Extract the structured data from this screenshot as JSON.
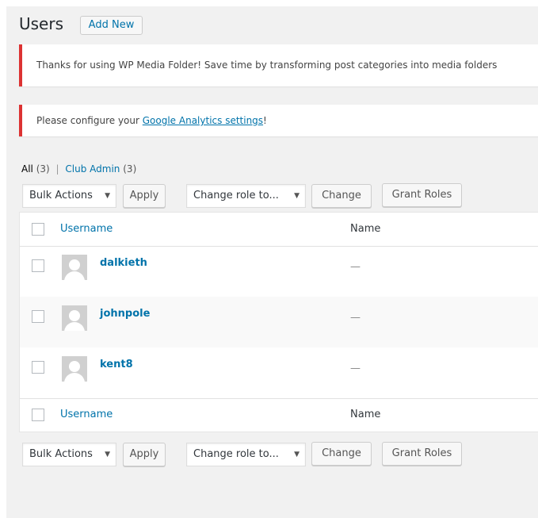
{
  "page": {
    "title": "Users",
    "add_new_label": "Add New"
  },
  "notices": {
    "wpmf": "Thanks for using WP Media Folder! Save time by transforming post categories into media folders",
    "ga_prefix": "Please configure your ",
    "ga_link": "Google Analytics settings",
    "ga_suffix": "!"
  },
  "filters": {
    "all_label": "All",
    "all_count": "(3)",
    "separator": "|",
    "club_admin_label": "Club Admin",
    "club_admin_count": "(3)"
  },
  "actions": {
    "bulk_actions": "Bulk Actions",
    "apply": "Apply",
    "change_role": "Change role to...",
    "change": "Change",
    "grant_roles": "Grant Roles"
  },
  "table": {
    "columns": {
      "username": "Username",
      "name": "Name"
    },
    "rows": [
      {
        "username": "dalkieth",
        "name": "—"
      },
      {
        "username": "johnpole",
        "name": "—"
      },
      {
        "username": "kent8",
        "name": "—"
      }
    ]
  },
  "icons": {
    "dropdown": "caret-down-icon",
    "avatar": "default-avatar-icon"
  },
  "colors": {
    "link": "#0073aa",
    "notice_error": "#dc3232",
    "background": "#f1f1f1"
  }
}
